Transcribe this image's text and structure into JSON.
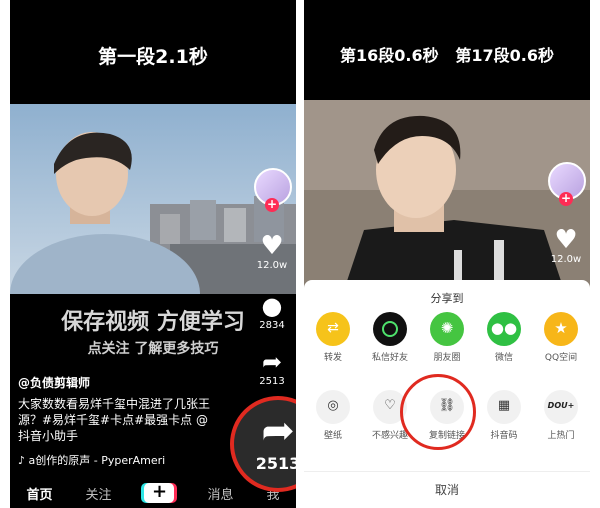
{
  "left_panel": {
    "caption": "第一段2.1秒",
    "overlay_title": "保存视频 方便学习",
    "overlay_subtitle": "点关注 了解更多技巧",
    "likes": "12.0w",
    "comments": "2834",
    "shares": "2513",
    "username": "@负债剪辑师",
    "description": "大家数数看易烊千玺中混进了几张王源？#易烊千玺#卡点#最强卡点 @抖音小助手",
    "music": "a创作的原声 - PyperAmeri",
    "big_share_count": "2513",
    "nav": [
      "首页",
      "关注",
      "+",
      "消息",
      "我"
    ]
  },
  "right_panel": {
    "caption": "第16段0.6秒   第17段0.6秒",
    "likes": "12.0w",
    "sheet": {
      "title": "分享到",
      "row1": [
        {
          "label": "转发",
          "icon": "repost-icon",
          "color": "#f6c31a"
        },
        {
          "label": "私信好友",
          "icon": "message-friend-icon",
          "color": "#111111"
        },
        {
          "label": "朋友圈",
          "icon": "moments-icon",
          "color": "#45c541"
        },
        {
          "label": "微信",
          "icon": "wechat-icon",
          "color": "#2fc043"
        },
        {
          "label": "QQ空间",
          "icon": "qzone-icon",
          "color": "#f7b619"
        }
      ],
      "row2": [
        {
          "label": "壁纸",
          "icon": "wallpaper-icon"
        },
        {
          "label": "不感兴趣",
          "icon": "broken-heart-icon"
        },
        {
          "label": "复制链接",
          "icon": "link-icon"
        },
        {
          "label": "抖音码",
          "icon": "qr-code-icon"
        },
        {
          "label": "上热门",
          "icon": "dou-plus-icon"
        }
      ],
      "cancel": "取消"
    }
  },
  "accent_red": "#e02a20"
}
